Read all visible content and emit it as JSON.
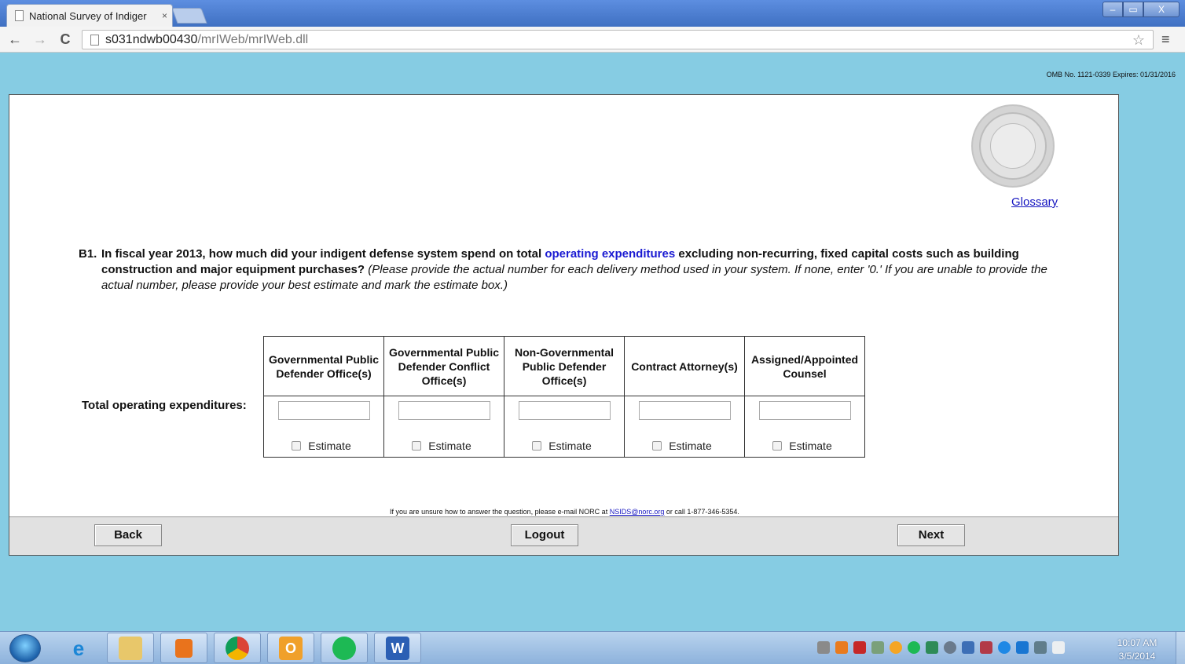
{
  "browser": {
    "tab_title": "National Survey of Indiger",
    "tab_close": "×",
    "url_host": "s031ndwb00430",
    "url_path": "/mrIWeb/mrIWeb.dll",
    "window_buttons": {
      "minimize": "–",
      "maximize": "▭",
      "close": "X"
    }
  },
  "page": {
    "omb_notice": "OMB No. 1121-0339 Expires: 01/31/2016",
    "glossary_link": "Glossary",
    "question": {
      "number": "B1.",
      "text_before_term": "In fiscal year 2013, how much did your indigent defense system spend on total ",
      "term": "operating expenditures",
      "text_after_term": " excluding non-recurring, fixed capital costs such as building construction and major equipment purchases?",
      "instructions": "(Please provide the actual number for each delivery method used in your system. If none, enter '0.' If you are unable to provide the actual number, please provide your best estimate and mark the estimate box.)"
    },
    "row_label": "Total operating expenditures:",
    "columns": [
      {
        "header": "Governmental Public Defender Office(s)",
        "input_value": "",
        "estimate_label": "Estimate",
        "estimate_checked": false
      },
      {
        "header": "Governmental Public Defender Conflict Office(s)",
        "input_value": "",
        "estimate_label": "Estimate",
        "estimate_checked": false
      },
      {
        "header": "Non-Governmental Public Defender Office(s)",
        "input_value": "",
        "estimate_label": "Estimate",
        "estimate_checked": false
      },
      {
        "header": "Contract Attorney(s)",
        "input_value": "",
        "estimate_label": "Estimate",
        "estimate_checked": false
      },
      {
        "header": "Assigned/Appointed Counsel",
        "input_value": "",
        "estimate_label": "Estimate",
        "estimate_checked": false
      }
    ],
    "contact": {
      "text_before": "If you are unsure how to answer the question, please e-mail NORC at ",
      "email": "NSIDS@norc.org",
      "text_after": " or call 1-877-346-5354."
    },
    "buttons": {
      "back": "Back",
      "logout": "Logout",
      "next": "Next"
    }
  },
  "taskbar": {
    "apps": [
      "internet-explorer",
      "file-explorer",
      "media-player",
      "chrome",
      "outlook",
      "spotify",
      "word"
    ],
    "word_letter": "W",
    "outlook_letter": "O",
    "time": "10:07 AM",
    "date": "3/5/2014"
  },
  "colors": {
    "page_background": "#86cce3",
    "link_blue": "#1515c0",
    "term_blue": "#1a1ad2",
    "titlebar_blue": "#4f7fd0"
  }
}
